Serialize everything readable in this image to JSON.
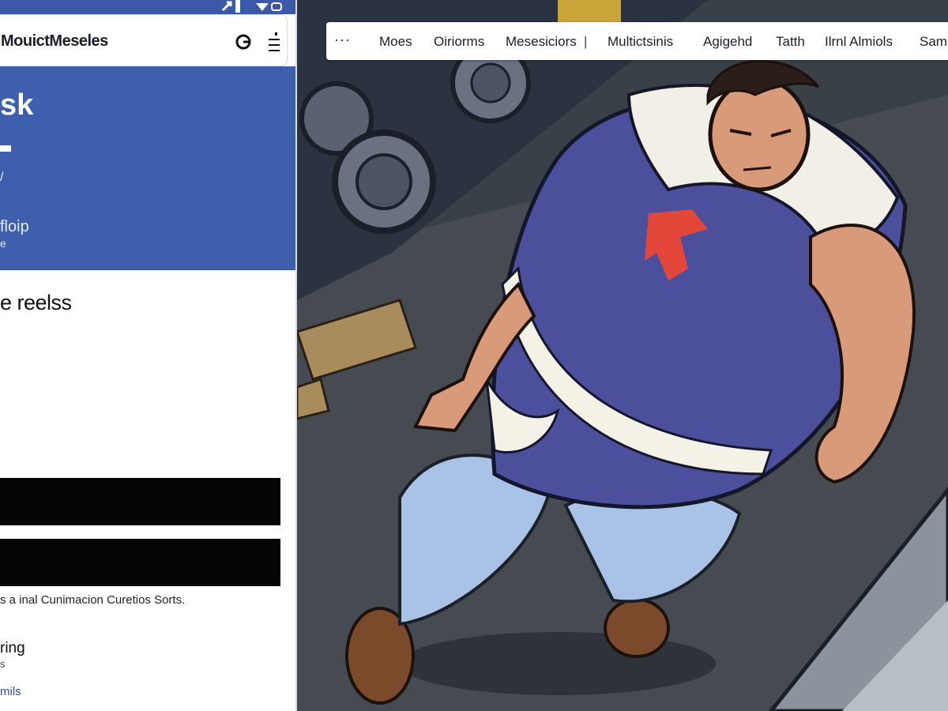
{
  "status": {
    "icon_left": "arrow-icon",
    "icon_right": "signal-icon"
  },
  "app": {
    "title": "MouictMeseles",
    "search_icon": "search-icon",
    "menu_icon": "menu-icon"
  },
  "hero": {
    "title": "sk",
    "small": "/",
    "link": "floip",
    "sub": "e",
    "color": "#3e5fae"
  },
  "section": {
    "title": "e reelss"
  },
  "content": {
    "description": "s a inal Cunimacion Curetios Sorts.",
    "item_title": "ring",
    "item_sub": "s",
    "item_link": "mils"
  },
  "nav": {
    "more_label": "···",
    "items": [
      "Moes",
      "Oiriorms",
      "Mesesiciors",
      "Multictsinis",
      "Agigehd",
      "Tatth",
      "Ilrnl Almiols",
      "Sami"
    ],
    "separator": "|"
  },
  "artwork": {
    "description_name": "comic-illustration"
  }
}
